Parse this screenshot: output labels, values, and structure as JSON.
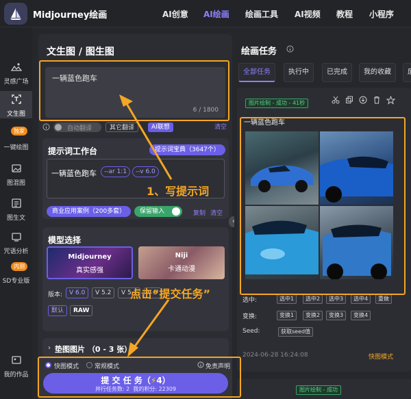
{
  "app": {
    "brand": "Midjourney绘画"
  },
  "nav": [
    {
      "label": "AI创意",
      "active": false
    },
    {
      "label": "AI绘画",
      "active": true
    },
    {
      "label": "绘画工具",
      "active": false
    },
    {
      "label": "AI视频",
      "active": false
    },
    {
      "label": "教程",
      "active": false
    },
    {
      "label": "小程序",
      "active": false
    }
  ],
  "sidebar": {
    "items": [
      {
        "label": "灵感广场"
      },
      {
        "label": "文生图"
      },
      {
        "label": "一键绘图",
        "badge": "独家"
      },
      {
        "label": "图混图"
      },
      {
        "label": "图生文"
      },
      {
        "label": "咒语分析"
      },
      {
        "label": "SD专业版",
        "badge": "内测"
      },
      {
        "label": "我的作品"
      }
    ]
  },
  "form": {
    "title": "文生图 / 图生图",
    "prompt_value": "一辆蓝色跑车",
    "counter": "6 / 1800",
    "options": {
      "auto_translate": "自动翻译",
      "other_translate": "其它翻译",
      "ai_think": "AI联想",
      "clear": "清空"
    },
    "workbench": {
      "title": "提示词工作台",
      "dict_button": "提示词宝典（3647个）",
      "text": "一辆蓝色跑车",
      "tags": [
        "--ar 1:1",
        "--v 6.0"
      ],
      "commercial": "商业应用案例（200多套）",
      "keep_input": "保留输入",
      "copy": "复制",
      "clear": "清空"
    },
    "model": {
      "title": "模型选择",
      "cards": [
        {
          "title": "Midjourney",
          "subtitle": "真实感强"
        },
        {
          "title": "Niji",
          "subtitle": "卡通动漫"
        }
      ],
      "version_label": "版本:",
      "versions": [
        "V 6.0",
        "V 5.2",
        "V 5.1",
        "V 5"
      ],
      "styles": [
        "默认",
        "RAW"
      ]
    },
    "pad": {
      "title": "垫图图片 （0 - 3 张）"
    },
    "mode": {
      "fast": "快图模式",
      "normal": "常规模式",
      "disclaimer": "免责声明"
    },
    "submit": {
      "label": "提 交 任 务",
      "cost_prefix": "（",
      "cost": "4",
      "cost_suffix": "）",
      "queue": "并行任务数: 2",
      "points": "我的积分: 22309"
    }
  },
  "tasks": {
    "title": "绘画任务",
    "tabs": [
      {
        "label": "全部任务",
        "active": true
      },
      {
        "label": "执行中",
        "active": false
      },
      {
        "label": "已完成",
        "active": false
      },
      {
        "label": "我的收藏",
        "active": false
      },
      {
        "label": "废",
        "active": false
      }
    ],
    "card": {
      "status": "图片绘制 - 成功 - 41秒",
      "prompt": "一辆蓝色跑车",
      "upscale_label": "选中:",
      "upscale": [
        "选中1",
        "选中2",
        "选中3",
        "选中4",
        "重做"
      ],
      "variation_label": "变换:",
      "variation": [
        "变换1",
        "变换2",
        "变换3",
        "变换4"
      ],
      "seed_label": "Seed:",
      "seed_button": "获取seed值",
      "time": "2024-06-28 16:24:08",
      "mode": "快图模式"
    },
    "next_status": "图片绘制 - 成功"
  },
  "annotations": {
    "step1": "1、写提示词",
    "step2": "点击“提交任务”"
  },
  "colors": {
    "accent": "#6b5fe8",
    "annotation": "#f5a623",
    "success": "#3aa56a"
  }
}
